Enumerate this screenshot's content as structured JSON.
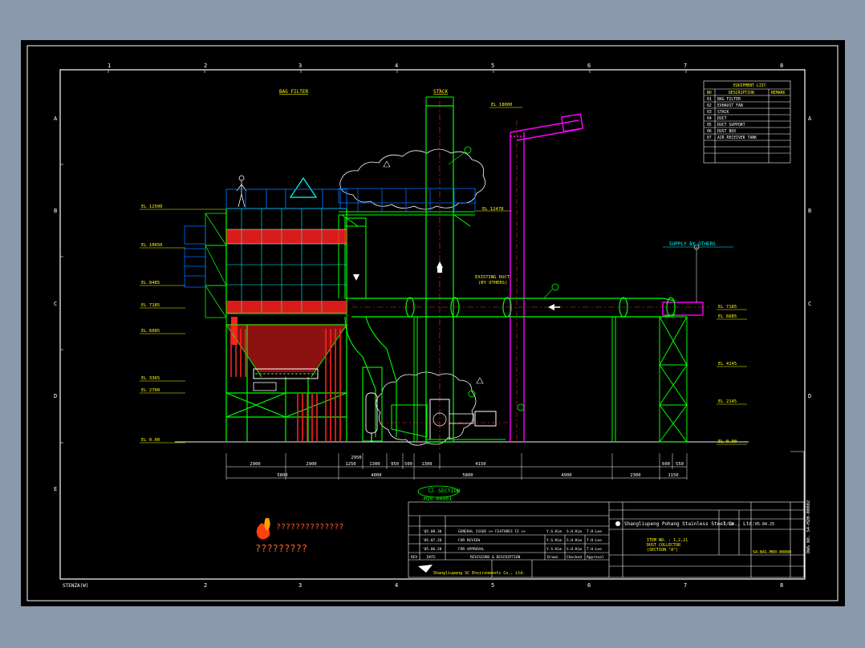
{
  "drawing": {
    "labels": {
      "bag_filter": "BAG FILTER",
      "stack": "STACK",
      "supply": "SUPPLY  BY OTHERS",
      "existing_duct": "EXISTING DUCT",
      "existing_duct_2": "(BY OTHERS)",
      "stack_top": "EL 18000"
    },
    "elevations_left": [
      "EL 12500",
      "EL 10650",
      "EL 8485",
      "EL 7185",
      "EL 6085",
      "EL 3365",
      "EL 2700",
      "EL 0.00"
    ],
    "elevations_right": [
      "EL 12478",
      "EL 7185",
      "EL 6685",
      "EL 4145",
      "EL 2145",
      "EL 0.00"
    ],
    "dims_upper": [
      "2900",
      "2900",
      "1250",
      "1300",
      "950",
      "500",
      "1300",
      "4150",
      "600",
      "550"
    ],
    "dims_lower": [
      "5800",
      "4000",
      "5800",
      "4900",
      "2300",
      "1150"
    ],
    "dim_extra": "2950",
    "section_label": "SECTION",
    "section_ref": "-M20-00001",
    "column_numbers": [
      "1",
      "2",
      "3",
      "4",
      "5",
      "6",
      "7",
      "8"
    ],
    "row_letters": [
      "A",
      "B",
      "C",
      "D",
      "E"
    ],
    "bottom_left_code": "STENZA(W)"
  },
  "equipment_list": {
    "title": "EQUIPMENT LIST",
    "headers": [
      "NO",
      "DESCRIPTION",
      "REMARK"
    ],
    "rows": [
      [
        "01",
        "BAG FILTER"
      ],
      [
        "02",
        "EXHAUST FAN"
      ],
      [
        "03",
        "STACK"
      ],
      [
        "04",
        "DUCT"
      ],
      [
        "05",
        "DUCT SUPPORT"
      ],
      [
        "06",
        "DUST BOX"
      ],
      [
        "07",
        "AIR RECEIVER TANK"
      ]
    ]
  },
  "revisions": [
    {
      "date": "'05.08.30",
      "text": "GENERAL ISSUE >> FEATURES II >>",
      "a": "Y.S.Kim",
      "b": "S.H.Kim",
      "c": "T.H.Lee"
    },
    {
      "date": "'05.07.20",
      "text": "FOR REVIEW",
      "a": "Y.S.Kim",
      "b": "S.H.Kim",
      "c": "T.H.Lee"
    },
    {
      "date": "'05.06.28",
      "text": "FOR APPROVAL",
      "a": "Y.S.Kim",
      "b": "S.H.Kim",
      "c": "T.H.Lee"
    }
  ],
  "revision_header": [
    "REV",
    "DATE",
    "REVISIONS & DESCRIPTION",
    "Drawn",
    "Checked",
    "Approval"
  ],
  "company_top": "Shangliupeng Pohang Stainless Steel Co., Ltd.",
  "scale": "1/50",
  "date": "'05.04.25",
  "item_title": [
    "ITEM NO. : 1,2,21",
    "DUST COLLECTOR",
    "(SECTION \"A\")"
  ],
  "drawing_no": "S4-B41-M00-00000",
  "company_bottom": "Shangliupeng SC Environments Co., Ltd.",
  "chinese_brand": "??????????????",
  "chinese_sub": "?????????",
  "side_text": "DWG NO. S4-M20-00002"
}
